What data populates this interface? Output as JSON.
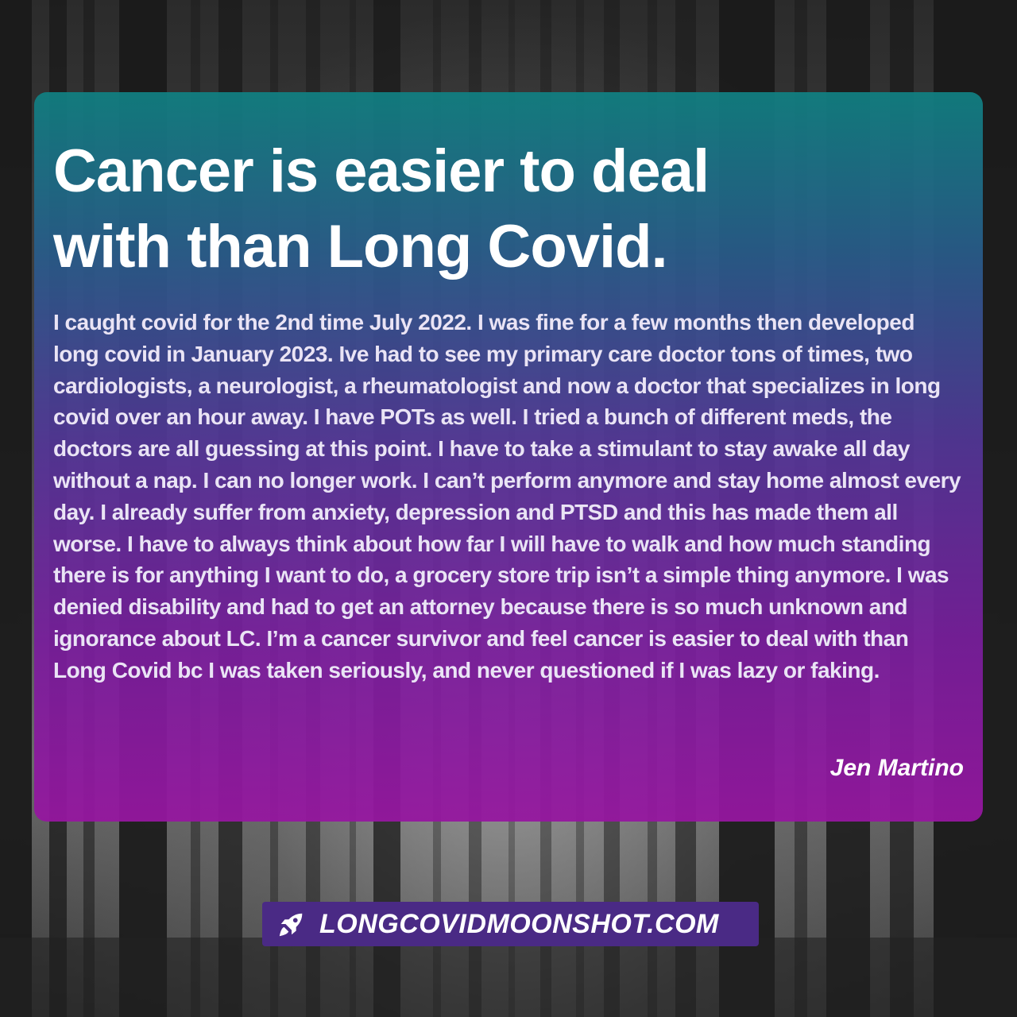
{
  "card": {
    "title_line1": "Cancer is easier to deal",
    "title_line2": "with than Long Covid.",
    "body": "I caught covid for the 2nd time July 2022. I was fine for a few months then developed long covid in January 2023. Ive had to see my primary care doctor tons of times, two cardiologists, a neurologist, a rheumatologist and now a doctor that specializes in long covid over an hour away. I have POTs as well. I tried a bunch of different meds, the doctors are all guessing at this point. I have to take a stimulant to stay awake all day without a nap. I can no longer work. I can’t perform anymore and stay home almost every day. I already suffer from anxiety, depression and PTSD and this has made them all worse. I have to always think about how far I will have to walk and how much standing there is for anything I want to do, a grocery store trip isn’t a simple thing anymore. I was denied disability and had to get an attorney because there is so much unknown and ignorance about LC. I’m a  cancer survivor and feel cancer is easier to deal with than Long Covid bc I was taken seriously, and never questioned if I was lazy or faking.",
    "author": "Jen Martino"
  },
  "badge": {
    "icon": "rocket-icon",
    "text": "LONGCOVIDMOONSHOT.COM"
  },
  "colors": {
    "card_top": "#108082",
    "card_bottom": "#9616a0",
    "badge_bg": "#4a2a85"
  }
}
